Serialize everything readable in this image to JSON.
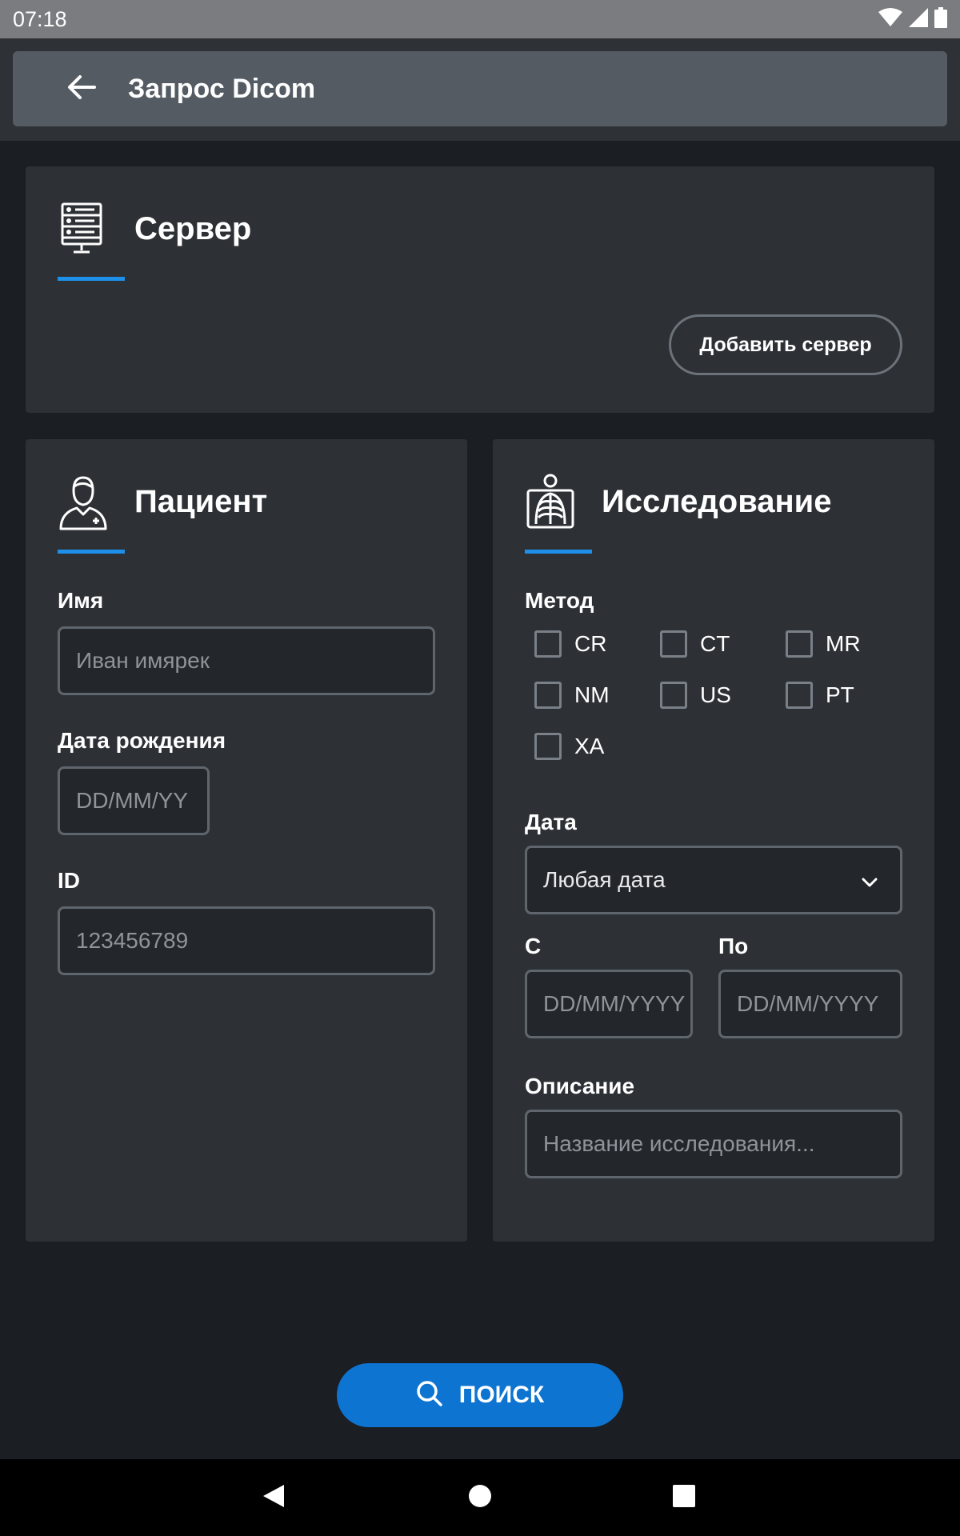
{
  "status_bar": {
    "time": "07:18",
    "icons": [
      "wifi-icon",
      "signal-icon",
      "battery-icon"
    ]
  },
  "appbar": {
    "title": "Запрос Dicom",
    "back_icon": "arrow-left-icon"
  },
  "server_card": {
    "title": "Сервер",
    "icon": "server-icon",
    "add_button": "Добавить сервер"
  },
  "patient_card": {
    "title": "Пациент",
    "icon": "patient-icon",
    "name_label": "Имя",
    "name_placeholder": "Иван имярек",
    "dob_label": "Дата рождения",
    "dob_placeholder": "DD/MM/YY",
    "id_label": "ID",
    "id_placeholder": "123456789"
  },
  "study_card": {
    "title": "Исследование",
    "icon": "xray-chest-icon",
    "method_label": "Метод",
    "methods": [
      "CR",
      "CT",
      "MR",
      "NM",
      "US",
      "PT",
      "XA"
    ],
    "date_label": "Дата",
    "date_value": "Любая дата",
    "from_label": "С",
    "from_placeholder": "DD/MM/YYYY",
    "to_label": "По",
    "to_placeholder": "DD/MM/YYYY",
    "description_label": "Описание",
    "description_placeholder": "Название исследования..."
  },
  "search_button": {
    "label": "ПОИСК",
    "icon": "search-icon"
  },
  "colors": {
    "accent": "#1e90ea",
    "primary_button": "#0d74d1",
    "background": "#1b1e22",
    "card": "#2d3136"
  }
}
